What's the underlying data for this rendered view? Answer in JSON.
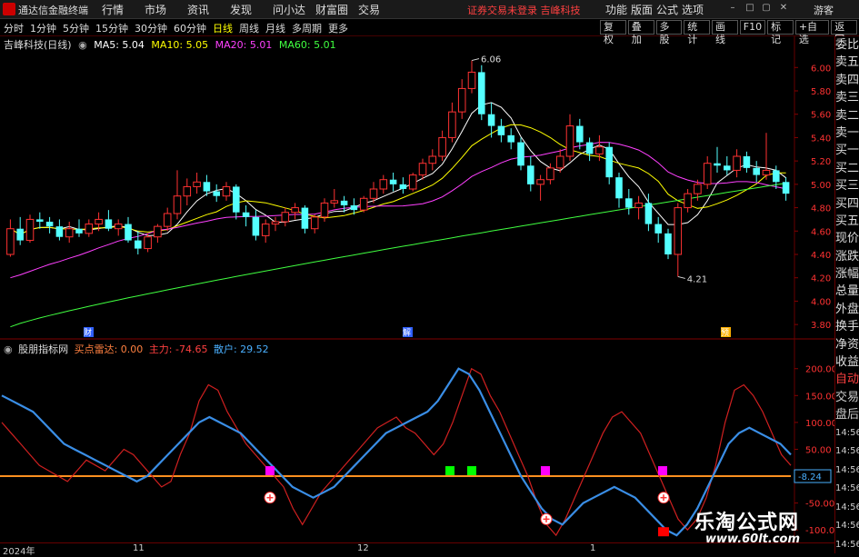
{
  "menubar": {
    "app_title": "通达信金融终端",
    "menus": [
      "行情",
      "市场",
      "资讯",
      "发现",
      "问小达",
      "财富圈",
      "交易"
    ],
    "warning": "证券交易未登录  吉峰科技",
    "right_menus": [
      "功能",
      "版面",
      "公式",
      "选项"
    ],
    "guest": "游客",
    "brand_color": "#cc0000"
  },
  "periodbar": {
    "periods": [
      "分时",
      "1分钟",
      "5分钟",
      "15分钟",
      "30分钟",
      "60分钟",
      "日线",
      "周线",
      "月线",
      "多周期",
      "更多"
    ],
    "active": "日线",
    "tools": [
      "复权",
      "叠加",
      "多股",
      "统计",
      "画线",
      "F10",
      "标记",
      "+自选",
      "返回"
    ]
  },
  "main_chart": {
    "stock": "吉峰科技(日线)",
    "ma": [
      {
        "label": "MA5: 5.04",
        "color": "#ffffff"
      },
      {
        "label": "MA10: 5.05",
        "color": "#ffff00"
      },
      {
        "label": "MA20: 5.01",
        "color": "#ff40ff"
      },
      {
        "label": "MA60: 5.01",
        "color": "#40ff40"
      }
    ],
    "high_label": "6.06",
    "low_label": "4.21",
    "markers": [
      "财",
      "解",
      "预"
    ]
  },
  "indicator": {
    "name": "股朋指标网",
    "fields": [
      {
        "label": "买点雷达: 0.00",
        "color": "#ff8040"
      },
      {
        "label": "主力: -74.65",
        "color": "#ff4040"
      },
      {
        "label": "散户: 29.52",
        "color": "#4ab0ff"
      }
    ],
    "value_box": "-8.24"
  },
  "right_panel": {
    "items": [
      "委比",
      "卖五",
      "卖四",
      "卖三",
      "卖二",
      "卖一",
      "买一",
      "买二",
      "买三",
      "买四",
      "买五",
      "现价",
      "涨跌",
      "涨幅",
      "总量",
      "外盘",
      "换手",
      "净资",
      "收益",
      "自动",
      "交易",
      "盘后",
      "14:56",
      "14:56",
      "14:56",
      "14:56",
      "14:56",
      "14:56",
      "14:56"
    ]
  },
  "date_axis": {
    "labels": [
      "2024年",
      "11",
      "12",
      "1"
    ]
  },
  "watermark": {
    "title": "乐淘公式网",
    "url": "www.60lt.com"
  },
  "chart_data": [
    {
      "type": "candlestick",
      "title": "",
      "ylim": [
        3.7,
        6.15
      ],
      "y_ticks": [
        6.0,
        5.8,
        5.6,
        5.4,
        5.2,
        5.0,
        4.8,
        4.6,
        4.4,
        4.2,
        4.0,
        3.8
      ],
      "up_color": "#ff3232",
      "down_color": "#54ffff",
      "ohlc": [
        [
          4.4,
          4.7,
          4.38,
          4.62
        ],
        [
          4.62,
          4.72,
          4.48,
          4.52
        ],
        [
          4.52,
          4.74,
          4.5,
          4.7
        ],
        [
          4.7,
          4.76,
          4.62,
          4.68
        ],
        [
          4.68,
          4.72,
          4.58,
          4.64
        ],
        [
          4.64,
          4.7,
          4.52,
          4.55
        ],
        [
          4.55,
          4.68,
          4.5,
          4.62
        ],
        [
          4.62,
          4.7,
          4.55,
          4.58
        ],
        [
          4.58,
          4.7,
          4.55,
          4.66
        ],
        [
          4.66,
          4.76,
          4.6,
          4.7
        ],
        [
          4.7,
          4.78,
          4.6,
          4.62
        ],
        [
          4.62,
          4.7,
          4.56,
          4.66
        ],
        [
          4.66,
          4.72,
          4.5,
          4.52
        ],
        [
          4.52,
          4.6,
          4.4,
          4.45
        ],
        [
          4.45,
          4.58,
          4.42,
          4.55
        ],
        [
          4.55,
          4.66,
          4.5,
          4.64
        ],
        [
          4.64,
          4.8,
          4.6,
          4.75
        ],
        [
          4.75,
          5.12,
          4.7,
          4.9
        ],
        [
          4.9,
          5.05,
          4.82,
          4.98
        ],
        [
          4.98,
          5.1,
          4.92,
          5.02
        ],
        [
          5.02,
          5.08,
          4.9,
          4.94
        ],
        [
          4.94,
          5.0,
          4.85,
          4.9
        ],
        [
          4.9,
          5.02,
          4.86,
          4.98
        ],
        [
          4.98,
          5.0,
          4.7,
          4.76
        ],
        [
          4.76,
          4.82,
          4.64,
          4.72
        ],
        [
          4.72,
          4.78,
          4.52,
          4.56
        ],
        [
          4.56,
          4.7,
          4.5,
          4.66
        ],
        [
          4.66,
          4.72,
          4.6,
          4.68
        ],
        [
          4.68,
          4.8,
          4.64,
          4.76
        ],
        [
          4.76,
          4.84,
          4.7,
          4.8
        ],
        [
          4.8,
          4.82,
          4.58,
          4.62
        ],
        [
          4.62,
          4.74,
          4.58,
          4.72
        ],
        [
          4.72,
          4.88,
          4.68,
          4.84
        ],
        [
          4.84,
          4.96,
          4.8,
          4.86
        ],
        [
          4.86,
          4.9,
          4.76,
          4.82
        ],
        [
          4.82,
          4.88,
          4.74,
          4.78
        ],
        [
          4.78,
          4.9,
          4.76,
          4.88
        ],
        [
          4.88,
          5.02,
          4.84,
          4.96
        ],
        [
          4.96,
          5.08,
          4.92,
          5.04
        ],
        [
          5.04,
          5.1,
          4.94,
          5.0
        ],
        [
          5.0,
          5.06,
          4.92,
          4.96
        ],
        [
          4.96,
          5.1,
          4.94,
          5.08
        ],
        [
          5.08,
          5.22,
          5.04,
          5.18
        ],
        [
          5.18,
          5.3,
          5.12,
          5.24
        ],
        [
          5.24,
          5.46,
          5.2,
          5.4
        ],
        [
          5.4,
          5.7,
          5.36,
          5.62
        ],
        [
          5.62,
          5.9,
          5.56,
          5.82
        ],
        [
          5.82,
          6.06,
          5.78,
          5.96
        ],
        [
          5.96,
          6.02,
          5.55,
          5.6
        ],
        [
          5.6,
          5.7,
          5.4,
          5.5
        ],
        [
          5.5,
          5.56,
          5.36,
          5.42
        ],
        [
          5.42,
          5.48,
          5.3,
          5.36
        ],
        [
          5.36,
          5.4,
          5.12,
          5.16
        ],
        [
          5.16,
          5.24,
          4.94,
          5.0
        ],
        [
          5.0,
          5.08,
          4.86,
          5.04
        ],
        [
          5.04,
          5.18,
          5.0,
          5.14
        ],
        [
          5.14,
          5.3,
          5.1,
          5.24
        ],
        [
          5.24,
          5.6,
          5.2,
          5.5
        ],
        [
          5.5,
          5.56,
          5.3,
          5.36
        ],
        [
          5.36,
          5.4,
          5.2,
          5.26
        ],
        [
          5.26,
          5.42,
          5.2,
          5.32
        ],
        [
          5.32,
          5.36,
          5.0,
          5.06
        ],
        [
          5.06,
          5.1,
          4.8,
          4.88
        ],
        [
          4.88,
          4.96,
          4.74,
          4.8
        ],
        [
          4.8,
          4.9,
          4.7,
          4.84
        ],
        [
          4.84,
          4.92,
          4.6,
          4.66
        ],
        [
          4.66,
          4.72,
          4.5,
          4.58
        ],
        [
          4.58,
          4.62,
          4.36,
          4.4
        ],
        [
          4.4,
          4.84,
          4.21,
          4.8
        ],
        [
          4.8,
          4.96,
          4.76,
          4.92
        ],
        [
          4.92,
          5.04,
          4.86,
          5.0
        ],
        [
          5.0,
          5.24,
          4.96,
          5.18
        ],
        [
          5.18,
          5.32,
          5.1,
          5.16
        ],
        [
          5.16,
          5.24,
          5.08,
          5.12
        ],
        [
          5.12,
          5.3,
          5.06,
          5.24
        ],
        [
          5.24,
          5.28,
          5.1,
          5.14
        ],
        [
          5.14,
          5.2,
          5.02,
          5.08
        ],
        [
          5.08,
          5.44,
          5.04,
          5.12
        ],
        [
          5.12,
          5.16,
          4.96,
          5.02
        ],
        [
          5.02,
          5.06,
          4.86,
          4.92
        ]
      ]
    },
    {
      "type": "line",
      "title": "",
      "ylim": [
        -120,
        230
      ],
      "y_ticks": [
        200,
        150,
        100,
        50,
        0,
        -50,
        -100
      ],
      "baseline": 0,
      "series": [
        {
          "name": "主力",
          "color": "#d02020",
          "values": [
            100,
            80,
            60,
            40,
            20,
            10,
            0,
            -10,
            10,
            30,
            20,
            10,
            30,
            50,
            40,
            20,
            0,
            -20,
            -10,
            40,
            80,
            140,
            170,
            160,
            120,
            90,
            60,
            40,
            20,
            0,
            -20,
            -60,
            -90,
            -60,
            -30,
            -10,
            10,
            30,
            50,
            70,
            90,
            100,
            110,
            90,
            80,
            60,
            40,
            60,
            100,
            150,
            200,
            190,
            150,
            120,
            80,
            40,
            0,
            -50,
            -90,
            -110,
            -80,
            -40,
            0,
            40,
            80,
            110,
            120,
            100,
            80,
            40,
            0,
            -40,
            -80,
            -100,
            -80,
            -40,
            20,
            100,
            160,
            170,
            150,
            120,
            80,
            40,
            20
          ]
        },
        {
          "name": "散户",
          "color": "#3a8ee6",
          "values": [
            150,
            140,
            130,
            120,
            100,
            80,
            60,
            50,
            40,
            30,
            20,
            10,
            0,
            -10,
            0,
            20,
            40,
            60,
            80,
            100,
            110,
            100,
            90,
            80,
            60,
            40,
            20,
            0,
            -20,
            -30,
            -40,
            -30,
            -20,
            0,
            20,
            40,
            60,
            80,
            90,
            100,
            110,
            120,
            140,
            170,
            200,
            190,
            160,
            120,
            80,
            40,
            0,
            -30,
            -60,
            -80,
            -90,
            -70,
            -50,
            -40,
            -30,
            -20,
            -30,
            -40,
            -60,
            -80,
            -100,
            -110,
            -90,
            -60,
            -20,
            20,
            60,
            80,
            90,
            80,
            70,
            60,
            40
          ]
        }
      ]
    }
  ]
}
